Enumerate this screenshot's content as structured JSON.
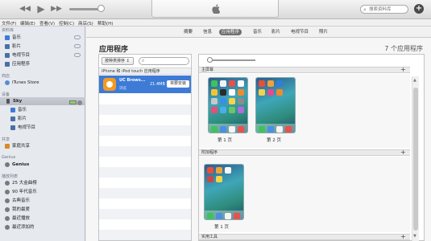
{
  "toolbar": {
    "search_placeholder": "搜索资料库",
    "icons": [
      "rewind-icon",
      "play-icon",
      "fast-forward-icon",
      "apple-icon",
      "search-icon",
      "add-icon"
    ]
  },
  "menu": [
    "文件(F)",
    "编辑(E)",
    "查看(V)",
    "控制(C)",
    "商店(S)",
    "帮助(H)"
  ],
  "sidebar": {
    "library_header": "资料库",
    "library": [
      {
        "label": "音乐",
        "icon": "music-icon",
        "color": "#3d7bd6"
      },
      {
        "label": "影片",
        "icon": "movie-icon",
        "color": "#4a6fa5"
      },
      {
        "label": "电视节目",
        "icon": "tv-icon",
        "color": "#4a6fa5"
      },
      {
        "label": "应用程序",
        "icon": "apps-icon",
        "color": "#4a6fa5"
      }
    ],
    "store_header": "商店",
    "store": [
      {
        "label": "iTunes Store",
        "icon": "store-icon",
        "color": "#5a8bd0"
      }
    ],
    "devices_header": "设备",
    "device": {
      "label": "Sky",
      "icon": "iphone-icon"
    },
    "device_items": [
      {
        "label": "音乐",
        "icon": "music-icon",
        "color": "#3d7bd6"
      },
      {
        "label": "影片",
        "icon": "movie-icon",
        "color": "#4a6fa5"
      },
      {
        "label": "电视节目",
        "icon": "tv-icon",
        "color": "#4a6fa5"
      }
    ],
    "shared_header": "共享",
    "shared": [
      {
        "label": "家庭共享",
        "icon": "home-sharing-icon",
        "color": "#d88a2b"
      }
    ],
    "genius_header": "Genius",
    "genius": [
      {
        "label": "Genius",
        "icon": "genius-icon",
        "color": "#7a7a7a"
      }
    ],
    "playlists_header": "播放列表",
    "playlists": [
      {
        "label": "25 大金曲榜",
        "icon": "smart-playlist-icon",
        "color": "#7a7a7a"
      },
      {
        "label": "90 年代音乐",
        "icon": "smart-playlist-icon",
        "color": "#7a7a7a"
      },
      {
        "label": "古典音乐",
        "icon": "smart-playlist-icon",
        "color": "#7a7a7a"
      },
      {
        "label": "我的最爱",
        "icon": "smart-playlist-icon",
        "color": "#7a7a7a"
      },
      {
        "label": "最近播放",
        "icon": "smart-playlist-icon",
        "color": "#7a7a7a"
      },
      {
        "label": "最近添加的",
        "icon": "smart-playlist-icon",
        "color": "#7a7a7a"
      }
    ]
  },
  "tabs": [
    "摘要",
    "信息",
    "应用程序",
    "音乐",
    "影片",
    "电视节目",
    "照片"
  ],
  "active_tab": 2,
  "main": {
    "title": "应用程序",
    "count": "7 个应用程序",
    "sort_label": "按种类排序 ↕",
    "list_header": "iPhone 和 iPod touch 应用程序",
    "app": {
      "name": "UC Brows...",
      "kind": "浏览",
      "size": "21.4MB",
      "action": "将要安装"
    },
    "sections": [
      "主屏幕",
      "附加程序",
      "实用工具"
    ],
    "pages": [
      "第 1 页",
      "第 2 页",
      "第 1 页"
    ]
  }
}
